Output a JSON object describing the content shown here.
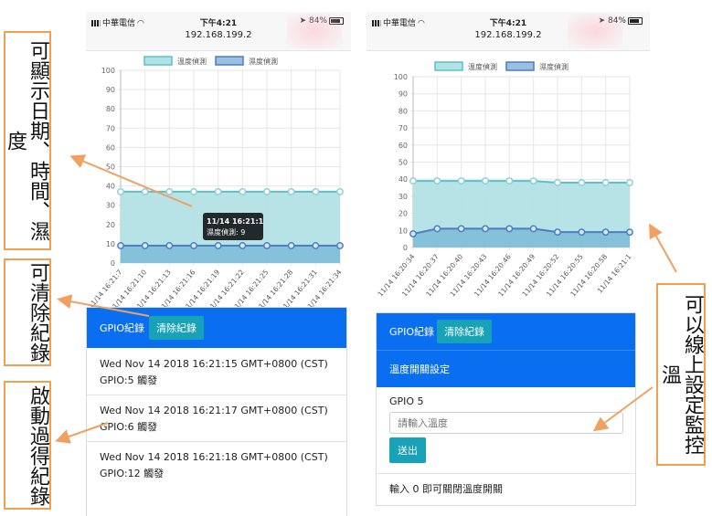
{
  "status_bar": {
    "carrier": "中華電信",
    "time": "下午4:21",
    "battery": "84%",
    "url": "192.168.199.2"
  },
  "left_phone": {
    "legend": [
      "溫度偵測",
      "濕度偵測"
    ],
    "chart_data": {
      "type": "line",
      "categories": [
        "11/14 16:21:7",
        "11/14 16:21:10",
        "11/14 16:21:13",
        "11/14 16:21:16",
        "11/14 16:21:19",
        "11/14 16:21:22",
        "11/14 16:21:25",
        "11/14 16:21:28",
        "11/14 16:21:31",
        "11/14 16:21:34"
      ],
      "series": [
        {
          "name": "溫度偵測",
          "values": [
            37,
            37,
            37,
            37,
            37,
            37,
            37,
            37,
            37,
            37
          ],
          "color": "#5bc0c8"
        },
        {
          "name": "濕度偵測",
          "values": [
            9,
            9,
            9,
            9,
            9,
            9,
            9,
            9,
            9,
            9
          ],
          "color": "#4a7fc1"
        }
      ],
      "ylim": [
        0,
        100
      ],
      "yticks": [
        0,
        10,
        20,
        30,
        40,
        50,
        60,
        70,
        80,
        90,
        100
      ],
      "grid": true,
      "legend_position": "top"
    },
    "tooltip": {
      "title": "11/14  16:21:1",
      "body": "濕度偵測: 9"
    },
    "gpio_card": {
      "title": "GPIO紀錄",
      "clear_label": "清除紀錄",
      "logs": [
        {
          "time": "Wed Nov 14 2018 16:21:15 GMT+0800 (CST)",
          "event": "GPIO:5 觸發"
        },
        {
          "time": "Wed Nov 14 2018 16:21:17 GMT+0800 (CST)",
          "event": "GPIO:6 觸發"
        },
        {
          "time": "Wed Nov 14 2018 16:21:18 GMT+0800 (CST)",
          "event": "GPIO:12 觸發"
        }
      ]
    }
  },
  "right_phone": {
    "legend": [
      "溫度偵測",
      "濕度偵測"
    ],
    "chart_data": {
      "type": "line",
      "categories": [
        "11/14 16:20:34",
        "11/14 16:20:37",
        "11/14 16:20:40",
        "11/14 16:20:43",
        "11/14 16:20:46",
        "11/14 16:20:49",
        "11/14 16:20:52",
        "11/14 16:20:55",
        "11/14 16:20:58",
        "11/14 16:21:1"
      ],
      "series": [
        {
          "name": "溫度偵測",
          "values": [
            39,
            39,
            39,
            39,
            39,
            39,
            38,
            38,
            38,
            38
          ],
          "color": "#5bc0c8"
        },
        {
          "name": "濕度偵測",
          "values": [
            8,
            11,
            11,
            11,
            11,
            11,
            9,
            9,
            9,
            9
          ],
          "color": "#4a7fc1"
        }
      ],
      "ylim": [
        0,
        100
      ],
      "yticks": [
        0,
        10,
        20,
        30,
        40,
        50,
        60,
        70,
        80,
        90,
        100
      ],
      "grid": true,
      "legend_position": "top"
    },
    "gpio_card": {
      "title": "GPIO紀錄",
      "clear_label": "清除紀錄",
      "switch_header": "溫度開關設定",
      "gpio_label": "GPIO 5",
      "input_placeholder": "請輸入溫度",
      "submit_label": "送出",
      "footer_note": "輸入 0 即可關閉溫度開關"
    }
  },
  "annotations": {
    "left_top": "可顯示日期、時間、濕度",
    "left_middle": "可清除紀錄",
    "left_bottom": "啟動過得紀錄",
    "right": "可以線上設定監控溫"
  },
  "colors": {
    "temp_fill": "#b3e2e6",
    "humid_fill": "#7fbcd6",
    "header_blue": "#0a6ef0",
    "teal_button": "#17a2b8",
    "annotation_border": "#f0a050",
    "arrow": "#f0a060"
  }
}
